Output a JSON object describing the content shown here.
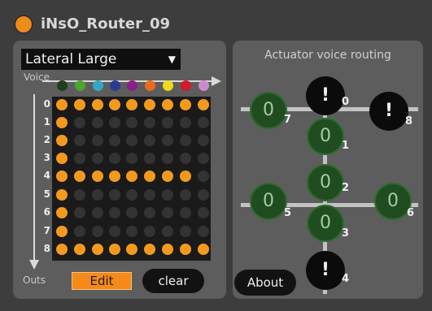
{
  "title": "iNsO_Router_09",
  "preset": {
    "value": "Lateral Large",
    "arrow": "▼"
  },
  "labels": {
    "voice": "Voice",
    "outs": "Outs",
    "routing_title": "Actuator voice routing"
  },
  "voice_colors": [
    "#1f3d1f",
    "#4da52b",
    "#31a9c4",
    "#283c94",
    "#8a1f8a",
    "#ee6a1a",
    "#f1da1a",
    "#d21a2a",
    "#cc8acc"
  ],
  "outs": [
    "0",
    "1",
    "2",
    "3",
    "4",
    "5",
    "6",
    "7",
    "8"
  ],
  "matrix": [
    [
      1,
      1,
      1,
      1,
      1,
      1,
      1,
      1,
      1
    ],
    [
      1,
      0,
      0,
      0,
      0,
      0,
      0,
      0,
      0
    ],
    [
      1,
      0,
      0,
      0,
      0,
      0,
      0,
      0,
      0
    ],
    [
      1,
      0,
      0,
      0,
      0,
      0,
      0,
      0,
      0
    ],
    [
      1,
      1,
      1,
      1,
      1,
      1,
      1,
      1,
      0
    ],
    [
      1,
      0,
      0,
      0,
      0,
      0,
      0,
      0,
      0
    ],
    [
      1,
      0,
      0,
      0,
      0,
      0,
      0,
      0,
      0
    ],
    [
      1,
      0,
      0,
      0,
      0,
      0,
      0,
      0,
      0
    ],
    [
      1,
      1,
      1,
      1,
      1,
      1,
      1,
      1,
      1
    ]
  ],
  "buttons": {
    "edit": "Edit",
    "clear": "clear",
    "about": "About"
  },
  "actuators": [
    {
      "id": "0",
      "value": "!",
      "state": "warning"
    },
    {
      "id": "1",
      "value": "0",
      "state": "ok"
    },
    {
      "id": "2",
      "value": "0",
      "state": "ok"
    },
    {
      "id": "3",
      "value": "0",
      "state": "ok"
    },
    {
      "id": "4",
      "value": "!",
      "state": "warning"
    },
    {
      "id": "5",
      "value": "0",
      "state": "ok"
    },
    {
      "id": "6",
      "value": "0",
      "state": "ok"
    },
    {
      "id": "7",
      "value": "0",
      "state": "ok"
    },
    {
      "id": "8",
      "value": "!",
      "state": "warning"
    }
  ]
}
